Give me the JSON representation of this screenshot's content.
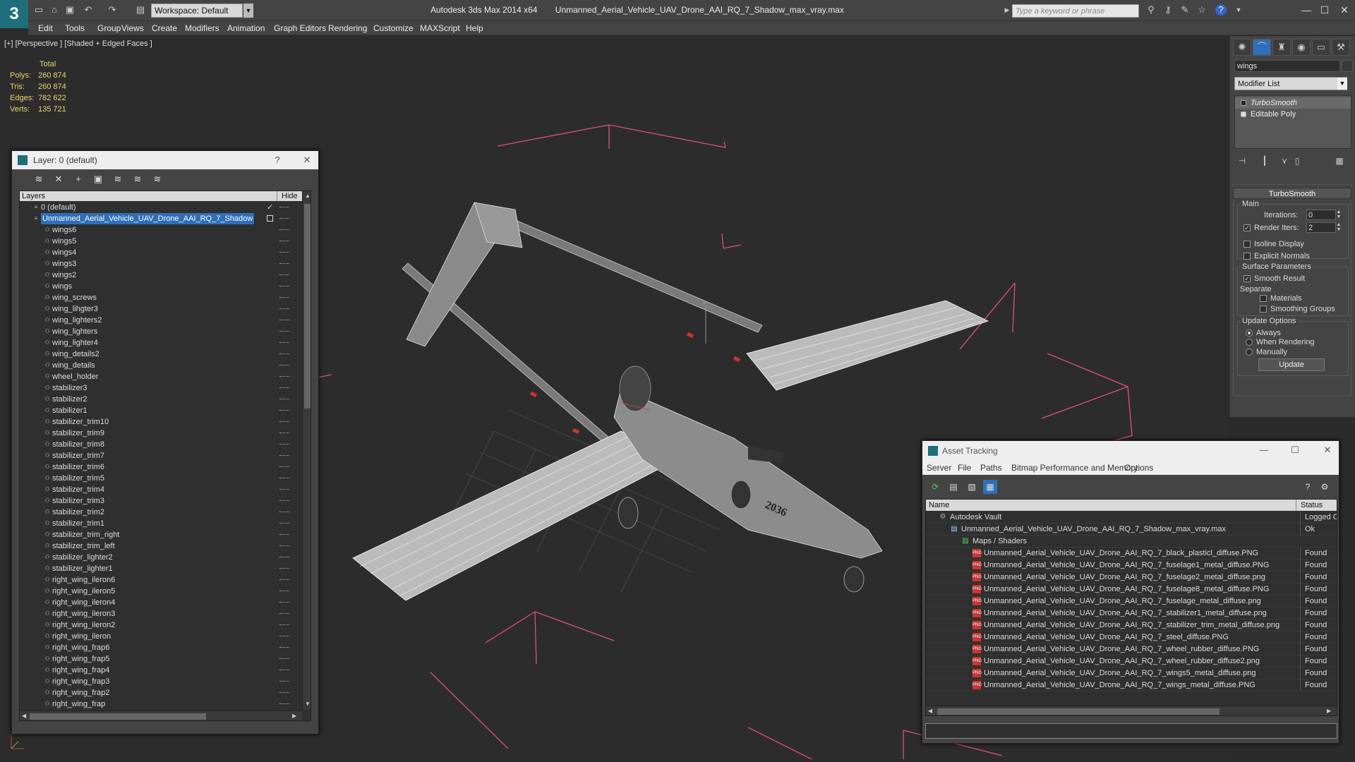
{
  "title_bar": {
    "app_name": "Autodesk 3ds Max  2014 x64",
    "file_name": "Unmanned_Aerial_Vehicle_UAV_Drone_AAI_RQ_7_Shadow_max_vray.max",
    "workspace_label": "Workspace: Default",
    "search_placeholder": "Type a keyword or phrase"
  },
  "menu": [
    "Edit",
    "Tools",
    "Group",
    "Views",
    "Create",
    "Modifiers",
    "Animation",
    "Graph Editors",
    "Rendering",
    "Customize",
    "MAXScript",
    "Help"
  ],
  "viewport": {
    "label": "[+] [Perspective ] [Shaded + Edged Faces ]",
    "stats_header": "Total",
    "stats": [
      {
        "label": "Polys:",
        "value": "260 874"
      },
      {
        "label": "Tris:",
        "value": "260 874"
      },
      {
        "label": "Edges:",
        "value": "782 622"
      },
      {
        "label": "Verts:",
        "value": "135 721"
      }
    ],
    "fuselage_number": "2036",
    "axis_label": "z"
  },
  "command_panel": {
    "object_name": "wings",
    "modifier_list_label": "Modifier List",
    "stack": [
      "TurboSmooth",
      "Editable Poly"
    ],
    "turbosmooth": {
      "header": "TurboSmooth",
      "main_label": "Main",
      "iterations_label": "Iterations:",
      "iterations_value": "0",
      "render_iters_label": "Render Iters:",
      "render_iters_value": "2",
      "isoline_label": "Isoline Display",
      "explicit_normals_label": "Explicit Normals",
      "surface_params_label": "Surface Parameters",
      "smooth_result_label": "Smooth Result",
      "separate_label": "Separate",
      "materials_label": "Materials",
      "smoothing_groups_label": "Smoothing Groups",
      "update_options_label": "Update Options",
      "always_label": "Always",
      "when_rendering_label": "When Rendering",
      "manually_label": "Manually",
      "update_button": "Update"
    }
  },
  "layer_dialog": {
    "title": "Layer: 0 (default)",
    "help": "?",
    "close": "✕",
    "col_layers": "Layers",
    "col_hide": "Hide",
    "layers": [
      {
        "name": "0 (default)",
        "level": 0
      },
      {
        "name": "Unmanned_Aerial_Vehicle_UAV_Drone_AAI_RQ_7_Shadow",
        "level": 0,
        "selected": true
      },
      {
        "name": "wings6",
        "level": 1
      },
      {
        "name": "wings5",
        "level": 1
      },
      {
        "name": "wings4",
        "level": 1
      },
      {
        "name": "wings3",
        "level": 1
      },
      {
        "name": "wings2",
        "level": 1
      },
      {
        "name": "wings",
        "level": 1
      },
      {
        "name": "wing_screws",
        "level": 1
      },
      {
        "name": "wing_lihgter3",
        "level": 1
      },
      {
        "name": "wing_lighters2",
        "level": 1
      },
      {
        "name": "wing_lighters",
        "level": 1
      },
      {
        "name": "wing_lighter4",
        "level": 1
      },
      {
        "name": "wing_details2",
        "level": 1
      },
      {
        "name": "wing_details",
        "level": 1
      },
      {
        "name": "wheel_holder",
        "level": 1
      },
      {
        "name": "stabilizer3",
        "level": 1
      },
      {
        "name": "stabilizer2",
        "level": 1
      },
      {
        "name": "stabilizer1",
        "level": 1
      },
      {
        "name": "stabilizer_trim10",
        "level": 1
      },
      {
        "name": "stabilizer_trim9",
        "level": 1
      },
      {
        "name": "stabilizer_trim8",
        "level": 1
      },
      {
        "name": "stabilizer_trim7",
        "level": 1
      },
      {
        "name": "stabilizer_trim6",
        "level": 1
      },
      {
        "name": "stabilizer_trim5",
        "level": 1
      },
      {
        "name": "stabilizer_trim4",
        "level": 1
      },
      {
        "name": "stabilizer_trim3",
        "level": 1
      },
      {
        "name": "stabilizer_trim2",
        "level": 1
      },
      {
        "name": "stabilizer_trim1",
        "level": 1
      },
      {
        "name": "stabilizer_trim_right",
        "level": 1
      },
      {
        "name": "stabilizer_trim_left",
        "level": 1
      },
      {
        "name": "stabilizer_lighter2",
        "level": 1
      },
      {
        "name": "stabilizer_lighter1",
        "level": 1
      },
      {
        "name": "right_wing_ileron6",
        "level": 1
      },
      {
        "name": "right_wing_ileron5",
        "level": 1
      },
      {
        "name": "right_wing_ileron4",
        "level": 1
      },
      {
        "name": "right_wing_ileron3",
        "level": 1
      },
      {
        "name": "right_wing_ileron2",
        "level": 1
      },
      {
        "name": "right_wing_ileron",
        "level": 1
      },
      {
        "name": "right_wing_frap6",
        "level": 1
      },
      {
        "name": "right_wing_frap5",
        "level": 1
      },
      {
        "name": "right_wing_frap4",
        "level": 1
      },
      {
        "name": "right_wing_frap3",
        "level": 1
      },
      {
        "name": "right_wing_frap2",
        "level": 1
      },
      {
        "name": "right_wing_frap",
        "level": 1
      }
    ]
  },
  "asset_tracking": {
    "title": "Asset Tracking",
    "menu": [
      "Server",
      "File",
      "Paths",
      "Bitmap Performance and Memory",
      "Options"
    ],
    "col_name": "Name",
    "col_status": "Status",
    "rows": [
      {
        "name": "Autodesk Vault",
        "status": "Logged O",
        "level": 0
      },
      {
        "name": "Unmanned_Aerial_Vehicle_UAV_Drone_AAI_RQ_7_Shadow_max_vray.max",
        "status": "Ok",
        "level": 1
      },
      {
        "name": "Maps / Shaders",
        "status": "",
        "level": 2
      },
      {
        "name": "Unmanned_Aerial_Vehicle_UAV_Drone_AAI_RQ_7_black_plasticl_diffuse.PNG",
        "status": "Found",
        "level": 3
      },
      {
        "name": "Unmanned_Aerial_Vehicle_UAV_Drone_AAI_RQ_7_fuselage1_metal_diffuse.PNG",
        "status": "Found",
        "level": 3
      },
      {
        "name": "Unmanned_Aerial_Vehicle_UAV_Drone_AAI_RQ_7_fuselage2_metal_diffuse.png",
        "status": "Found",
        "level": 3
      },
      {
        "name": "Unmanned_Aerial_Vehicle_UAV_Drone_AAI_RQ_7_fuselage8_metal_diffuse.PNG",
        "status": "Found",
        "level": 3
      },
      {
        "name": "Unmanned_Aerial_Vehicle_UAV_Drone_AAI_RQ_7_fuselage_metal_diffuse.png",
        "status": "Found",
        "level": 3
      },
      {
        "name": "Unmanned_Aerial_Vehicle_UAV_Drone_AAI_RQ_7_stabilizer1_metal_diffuse.png",
        "status": "Found",
        "level": 3
      },
      {
        "name": "Unmanned_Aerial_Vehicle_UAV_Drone_AAI_RQ_7_stabilizer_trim_metal_diffuse.png",
        "status": "Found",
        "level": 3
      },
      {
        "name": "Unmanned_Aerial_Vehicle_UAV_Drone_AAI_RQ_7_steel_diffuse.PNG",
        "status": "Found",
        "level": 3
      },
      {
        "name": "Unmanned_Aerial_Vehicle_UAV_Drone_AAI_RQ_7_wheel_rubber_diffuse.PNG",
        "status": "Found",
        "level": 3
      },
      {
        "name": "Unmanned_Aerial_Vehicle_UAV_Drone_AAI_RQ_7_wheel_rubber_diffuse2.png",
        "status": "Found",
        "level": 3
      },
      {
        "name": "Unmanned_Aerial_Vehicle_UAV_Drone_AAI_RQ_7_wings5_metal_diffuse.png",
        "status": "Found",
        "level": 3
      },
      {
        "name": "Unmanned_Aerial_Vehicle_UAV_Drone_AAI_RQ_7_wings_metal_diffuse.PNG",
        "status": "Found",
        "level": 3
      }
    ]
  },
  "colors": {
    "accent": "#1f6f7a",
    "selection": "#2f6fb7",
    "stats": "#e8d76a",
    "bbox": "#e0507a"
  }
}
